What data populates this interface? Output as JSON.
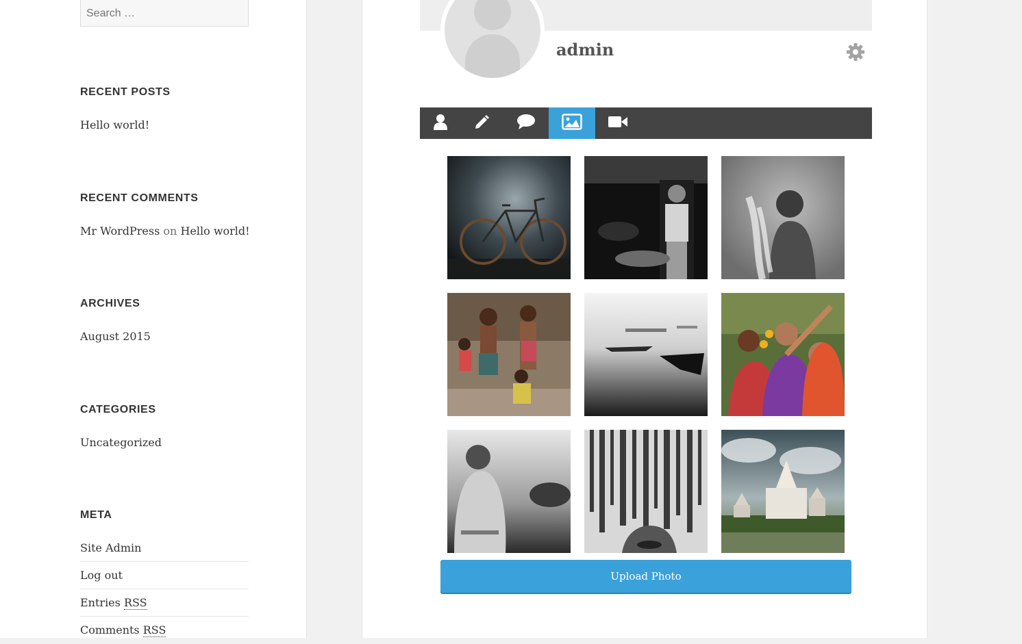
{
  "sidebar": {
    "search": {
      "placeholder": "Search …"
    },
    "recent_posts": {
      "title": "RECENT POSTS",
      "items": [
        "Hello world!"
      ]
    },
    "recent_comments": {
      "title": "RECENT COMMENTS",
      "author": "Mr WordPress",
      "connector": "on",
      "post": "Hello world!"
    },
    "archives": {
      "title": "ARCHIVES",
      "items": [
        "August 2015"
      ]
    },
    "categories": {
      "title": "CATEGORIES",
      "items": [
        "Uncategorized"
      ]
    },
    "meta": {
      "title": "META",
      "items": [
        {
          "label": "Site Admin"
        },
        {
          "label": "Log out"
        },
        {
          "label": "Entries ",
          "abbr": "RSS"
        },
        {
          "label": "Comments ",
          "abbr": "RSS"
        }
      ]
    }
  },
  "profile": {
    "username": "admin",
    "settings_icon": "gear-icon",
    "tabs": [
      {
        "icon": "user-icon",
        "active": false
      },
      {
        "icon": "pencil-icon",
        "active": false
      },
      {
        "icon": "comment-icon",
        "active": false
      },
      {
        "icon": "image-icon",
        "active": true
      },
      {
        "icon": "video-icon",
        "active": false
      }
    ],
    "photos": [
      "bicycle",
      "man-portrait",
      "girl-flowers",
      "children-group",
      "boats-river",
      "women-festival",
      "old-woman",
      "hanging-objects",
      "temple-clouds"
    ],
    "upload_label": "Upload Photo"
  },
  "colors": {
    "accent": "#3ba1da",
    "tabbar": "#444444",
    "cover": "#eeeeee"
  }
}
